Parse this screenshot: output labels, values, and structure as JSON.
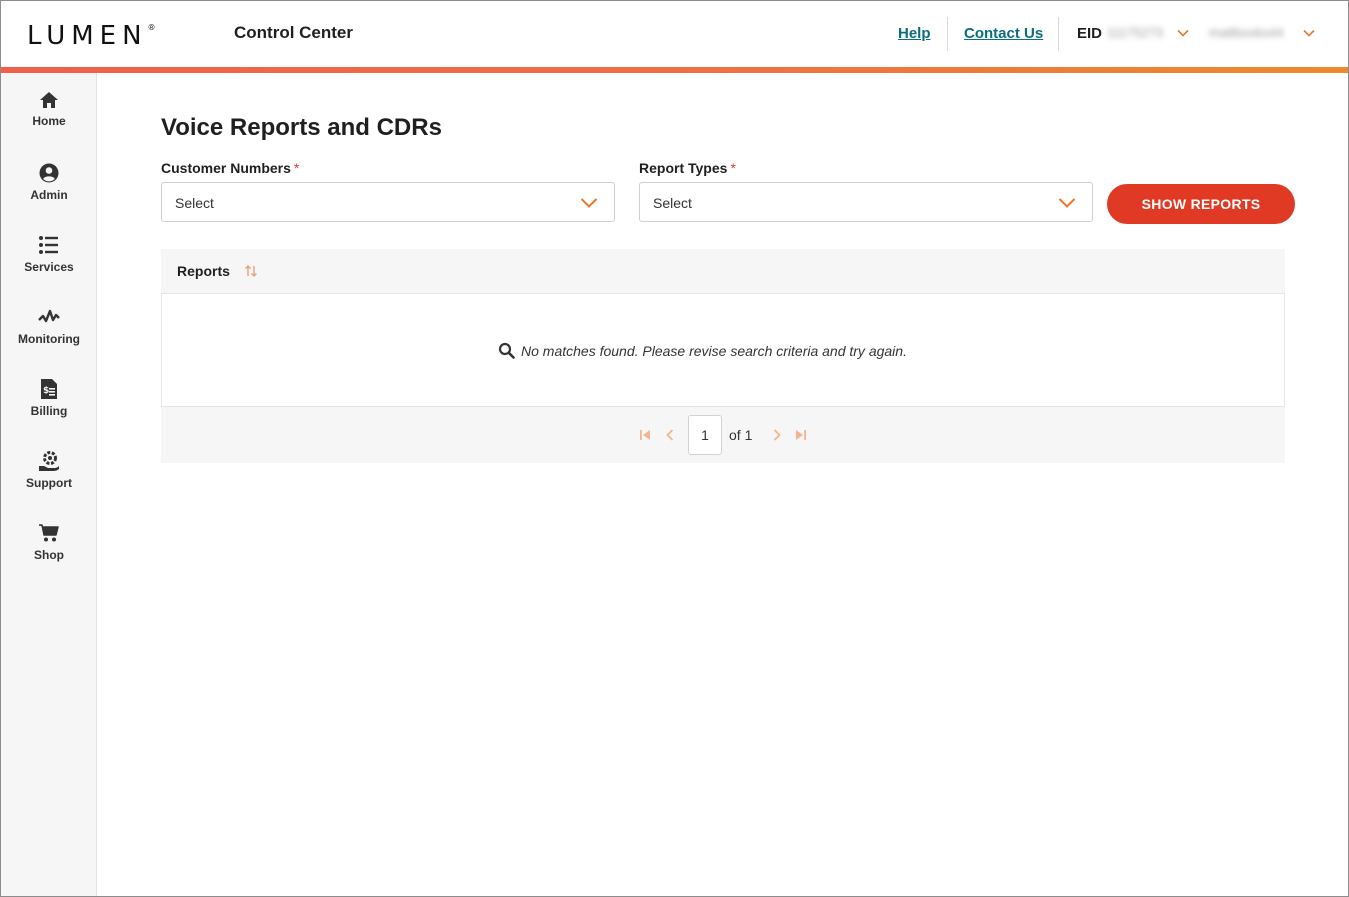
{
  "header": {
    "logo": "LUMEN",
    "logo_mark": "®",
    "app_title": "Control Center",
    "help_label": "Help",
    "contact_label": "Contact Us",
    "eid_label": "EID",
    "eid_value": "11175273",
    "user_name": "mattbooks44"
  },
  "sidebar": {
    "items": [
      {
        "label": "Home",
        "icon": "home-icon"
      },
      {
        "label": "Admin",
        "icon": "user-circle-icon"
      },
      {
        "label": "Services",
        "icon": "list-icon"
      },
      {
        "label": "Monitoring",
        "icon": "pulse-icon"
      },
      {
        "label": "Billing",
        "icon": "invoice-icon"
      },
      {
        "label": "Support",
        "icon": "support-gear-icon"
      },
      {
        "label": "Shop",
        "icon": "cart-icon"
      }
    ]
  },
  "main": {
    "title": "Voice Reports and CDRs",
    "customer_numbers": {
      "label": "Customer Numbers",
      "required": "*",
      "value": "Select"
    },
    "report_types": {
      "label": "Report Types",
      "required": "*",
      "value": "Select"
    },
    "show_reports_label": "SHOW REPORTS",
    "table": {
      "column": "Reports",
      "empty_message": "No matches found. Please revise search criteria and try again."
    },
    "pager": {
      "page": "1",
      "of_label": "of 1"
    }
  },
  "colors": {
    "accent": "#e03a24",
    "link": "#0a6d80",
    "icon_orange": "#e8782c"
  }
}
